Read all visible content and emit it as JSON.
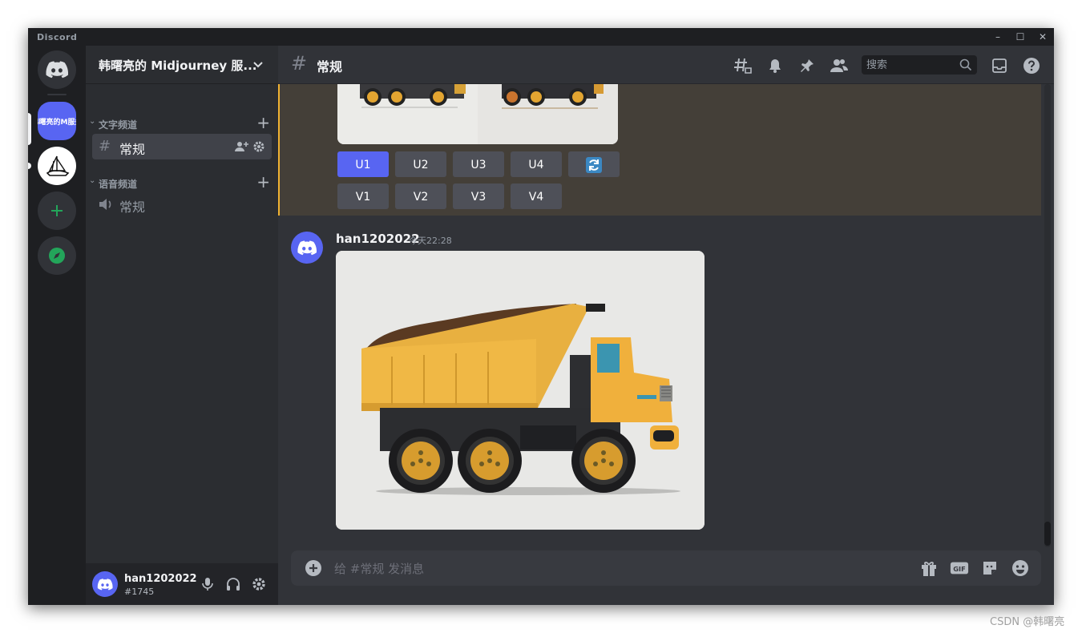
{
  "app": {
    "brand": "Discord"
  },
  "window_controls": {
    "minimize": "–",
    "maximize": "☐",
    "close": "✕"
  },
  "servers": [
    {
      "label": "韩曙亮的M服务",
      "active": true
    }
  ],
  "guild": {
    "name": "韩曙亮的 Midjourney 服..."
  },
  "categories": {
    "text": {
      "label": "文字频道",
      "add": "+"
    },
    "voice": {
      "label": "语音频道",
      "add": "+"
    }
  },
  "channels": {
    "text": [
      {
        "name": "常规",
        "active": true
      }
    ],
    "voice": [
      {
        "name": "常规"
      }
    ]
  },
  "header": {
    "hash": "#",
    "title": "常规",
    "search_placeholder": "搜索"
  },
  "upscale_buttons": [
    "U1",
    "U2",
    "U3",
    "U4"
  ],
  "variation_buttons": [
    "V1",
    "V2",
    "V3",
    "V4"
  ],
  "message": {
    "author": "han1202022",
    "timestamp": "今天22:28"
  },
  "composer": {
    "placeholder": "给 #常规 发消息"
  },
  "user": {
    "name": "han1202022",
    "tag": "#1745"
  },
  "watermark": "CSDN @韩曙亮",
  "colors": {
    "blurple": "#5865f2",
    "accent_gold": "#f0b232",
    "green": "#23a55a"
  }
}
